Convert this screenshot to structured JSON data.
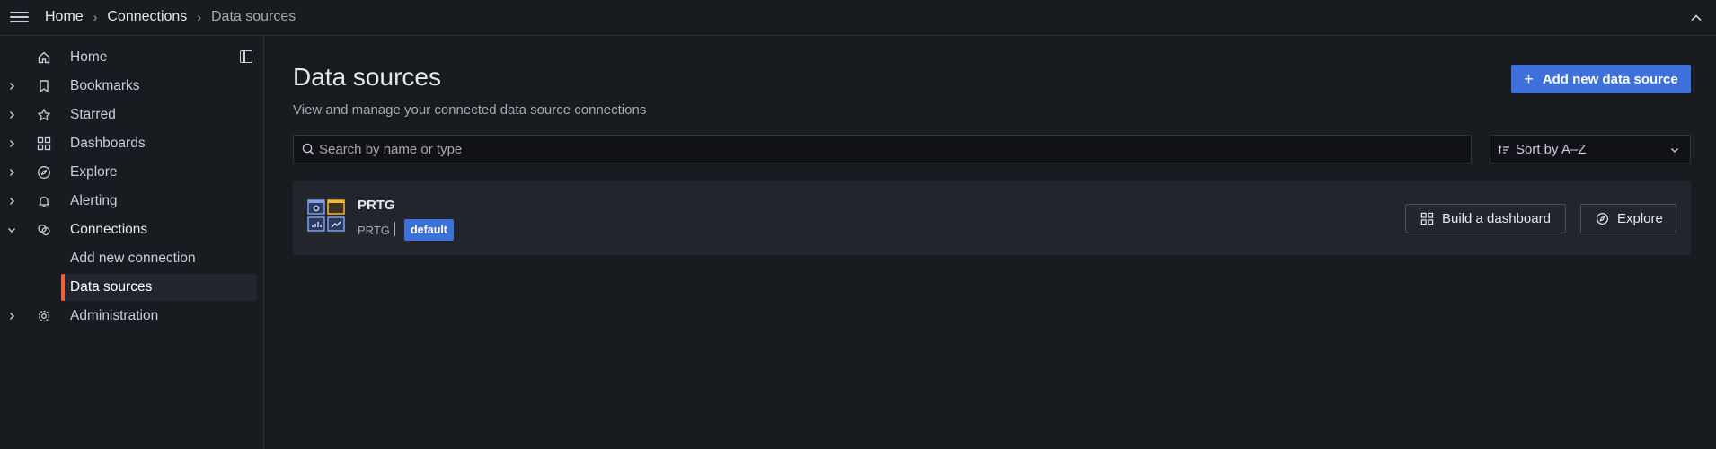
{
  "breadcrumbs": [
    {
      "label": "Home"
    },
    {
      "label": "Connections"
    },
    {
      "label": "Data sources"
    }
  ],
  "sidebar": {
    "items": [
      {
        "label": "Home",
        "icon": "home-icon",
        "expandable": false
      },
      {
        "label": "Bookmarks",
        "icon": "bookmark-icon",
        "expandable": true
      },
      {
        "label": "Starred",
        "icon": "star-icon",
        "expandable": true
      },
      {
        "label": "Dashboards",
        "icon": "apps-icon",
        "expandable": true
      },
      {
        "label": "Explore",
        "icon": "compass-icon",
        "expandable": true
      },
      {
        "label": "Alerting",
        "icon": "bell-icon",
        "expandable": true
      },
      {
        "label": "Connections",
        "icon": "link-icon",
        "expandable": true,
        "expanded": true
      },
      {
        "label": "Administration",
        "icon": "cog-icon",
        "expandable": true
      }
    ],
    "connections_children": [
      {
        "label": "Add new connection",
        "active": false
      },
      {
        "label": "Data sources",
        "active": true
      }
    ]
  },
  "main": {
    "title": "Data sources",
    "subtitle": "View and manage your connected data source connections",
    "add_button": "Add new data source",
    "search_placeholder": "Search by name or type",
    "sort_label": "Sort by A–Z",
    "datasources": [
      {
        "name": "PRTG",
        "type": "PRTG",
        "badge": "default",
        "build_button": "Build a dashboard",
        "explore_button": "Explore"
      }
    ]
  },
  "colors": {
    "background": "#181b1f",
    "card": "#22252b",
    "primary": "#3d71d9",
    "active_marker": "#f55f3e",
    "text": "#ccccdc"
  }
}
